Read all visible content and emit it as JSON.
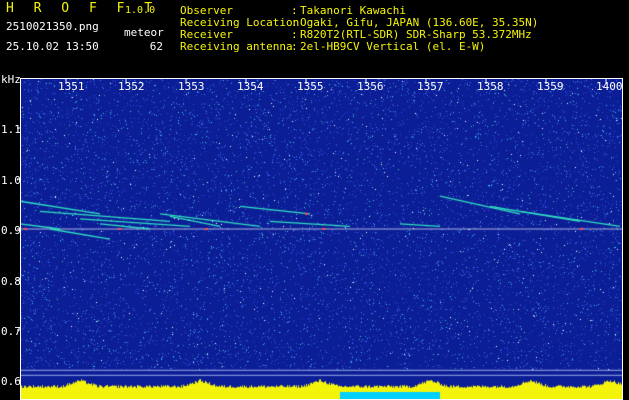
{
  "app": {
    "title": "H R O F F T",
    "version": "1.0.0"
  },
  "file_name": "2510021350.png",
  "timestamp": "25.10.02 13:50",
  "meteor": {
    "label": "meteor",
    "count": "62"
  },
  "info": [
    {
      "label": "Observer",
      "value": "Takanori Kawachi"
    },
    {
      "label": "Receiving Location",
      "value": "Ogaki, Gifu, JAPAN (136.60E, 35.35N)"
    },
    {
      "label": "Receiver",
      "value": "R820T2(RTL-SDR) SDR-Sharp 53.372MHz"
    },
    {
      "label": "Receiving antenna",
      "value": "2el-HB9CV Vertical (el. E-W)"
    }
  ],
  "axis": {
    "y_unit": "kHz",
    "y_ticks": [
      "1.1",
      "1.0",
      "0.9",
      "0.8",
      "0.7",
      "0.6"
    ],
    "x_ticks": [
      "1351",
      "1352",
      "1353",
      "1354",
      "1355",
      "1356",
      "1357",
      "1358",
      "1359",
      "1400"
    ]
  },
  "colors": {
    "background": "#000000",
    "spectrogram_bg": "#0c1e96",
    "header_yellow": "#f4f40a",
    "header_green": "#1ec81e",
    "trace": "#30e0c0",
    "carrier": "#ff5050",
    "power_bar": "#f4f40a",
    "power_bar_low": "#00d0ff"
  }
}
